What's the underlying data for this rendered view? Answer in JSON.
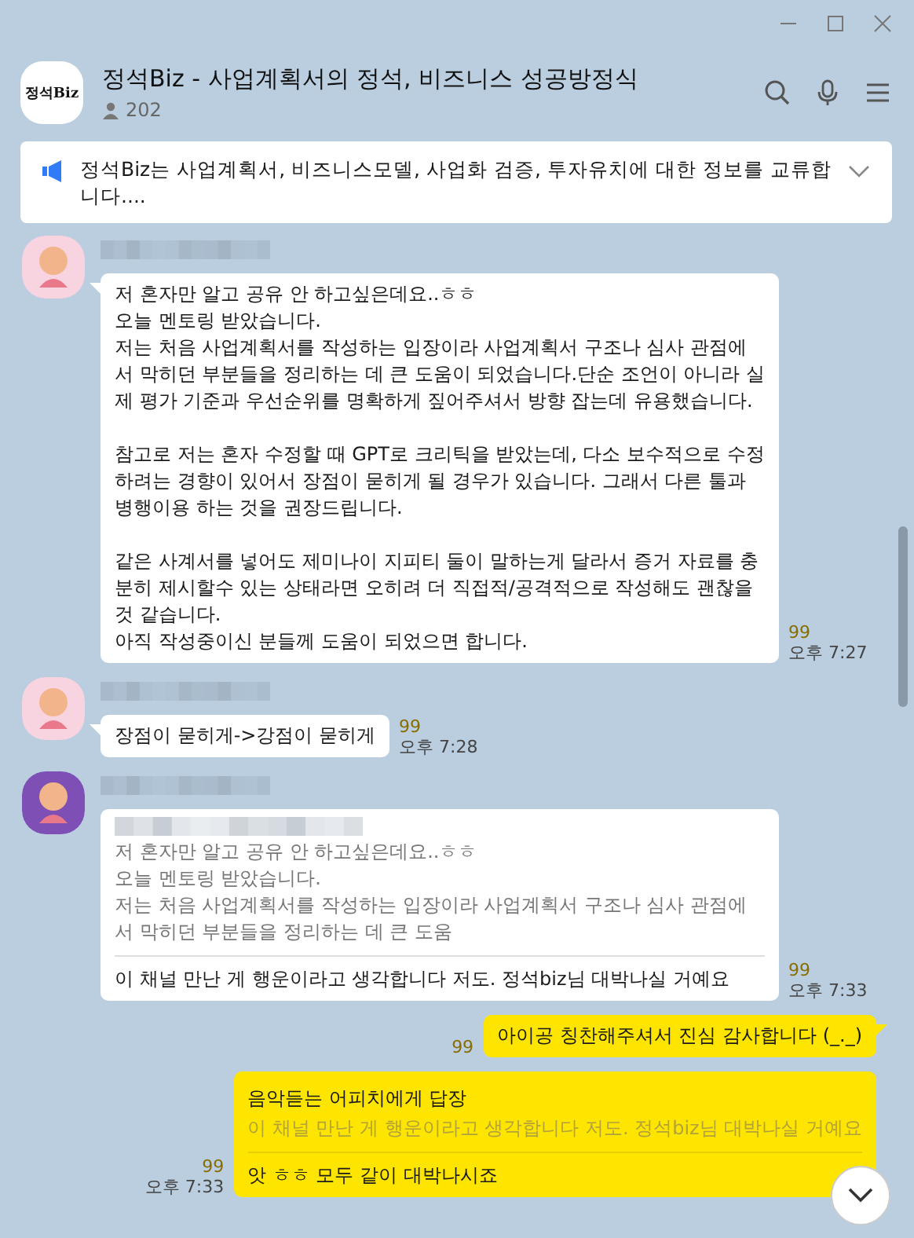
{
  "chat": {
    "logo_text": "정석Biz",
    "title": "정석Biz - 사업계획서의 정석, 비즈니스 성공방정식",
    "member_count": "202"
  },
  "notice": {
    "text": "정석Biz는 사업계획서, 비즈니스모델, 사업화 검증, 투자유치에 대한 정보를 교류합니다....",
    "expanded": false
  },
  "messages": [
    {
      "kind": "received",
      "color": "#f8d3e0",
      "text": "저 혼자만 알고 공유 안 하고싶은데요..ㅎㅎ\n오늘 멘토링 받았습니다.\n저는 처음 사업계획서를 작성하는 입장이라 사업계획서 구조나 심사 관점에서 막히던 부분들을 정리하는 데 큰 도움이 되었습니다.단순 조언이 아니라 실제 평가 기준과 우선순위를 명확하게 짚어주셔서 방향 잡는데 유용했습니다.\n\n참고로 저는 혼자 수정할 때 GPT로 크리틱을 받았는데, 다소 보수적으로 수정하려는 경향이 있어서 장점이 묻히게 될 경우가 있습니다. 그래서 다른 툴과 병행이용 하는 것을 권장드립니다.\n\n같은 사계서를 넣어도 제미나이 지피티 둘이 말하는게 달라서 증거 자료를 충분히 제시할수 있는 상태라면 오히려 더 직접적/공격적으로 작성해도 괜찮을 것 같습니다.\n아직 작성중이신 분들께 도움이 되었으면 합니다.",
      "unread": "99",
      "time": "오후 7:27"
    },
    {
      "kind": "received",
      "color": "#f8d3e0",
      "text": "장점이 묻히게->강점이 묻히게",
      "unread": "99",
      "time": "오후 7:28"
    },
    {
      "kind": "received",
      "color": "#7e4fb5",
      "reply": {
        "text": "저 혼자만 알고 공유 안 하고싶은데요..ㅎㅎ\n오늘 멘토링 받았습니다.\n저는 처음 사업계획서를 작성하는 입장이라 사업계획서 구조나 심사 관점에서 막히던 부분들을 정리하는 데 큰 도움"
      },
      "text": "이 채널 만난 게 행운이라고 생각합니다 저도. 정석biz님 대박나실 거예요",
      "unread": "99",
      "time": "오후 7:33"
    },
    {
      "kind": "sent",
      "text": "아이공 칭찬해주셔서 진심 감사합니다 (_._)",
      "unread": "99"
    },
    {
      "kind": "sent",
      "reply": {
        "to": "음악듣는 어피치에게 답장",
        "text": "이 채널 만난 게 행운이라고 생각합니다 저도. 정석biz님 대박나실 거예요"
      },
      "text": "앗 ㅎㅎ 모두 같이 대박나시죠",
      "unread": "99",
      "time": "오후 7:33"
    }
  ]
}
